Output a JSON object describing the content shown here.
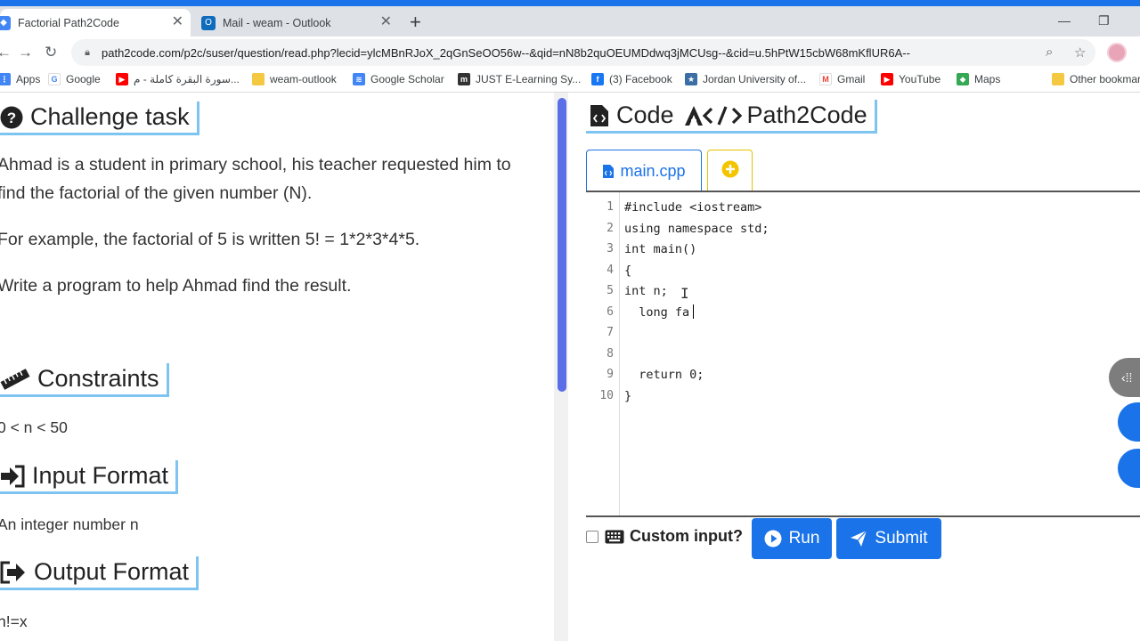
{
  "browser": {
    "tabs": [
      {
        "title": "Factorial Path2Code",
        "active": true,
        "favicon_color": "#4285f4"
      },
      {
        "title": "Mail - weam - Outlook",
        "active": false,
        "favicon_color": "#0f6cbd"
      }
    ],
    "url": "path2code.com/p2c/suser/question/read.php?lecid=ylcMBnRJoX_2qGnSeOO56w--&qid=nN8b2quOEUMDdwq3jMCUsg--&cid=u.5hPtW15cbW68mKflUR6A--",
    "bookmarks": [
      {
        "label": "Apps",
        "icon": "apps-icon",
        "color": "#4285f4"
      },
      {
        "label": "Google",
        "icon": "google-icon",
        "color": "#4285f4"
      },
      {
        "label": "سورة البقرة كاملة - م...",
        "icon": "youtube-icon",
        "color": "#ff0000"
      },
      {
        "label": "weam-outlook",
        "icon": "folder-icon",
        "color": "#f5c842"
      },
      {
        "label": "Google Scholar",
        "icon": "scholar-icon",
        "color": "#4285f4"
      },
      {
        "label": "JUST E-Learning Sy...",
        "icon": "just-icon",
        "color": "#333333"
      },
      {
        "label": "(3) Facebook",
        "icon": "facebook-icon",
        "color": "#1877f2"
      },
      {
        "label": "Jordan University of...",
        "icon": "juniv-icon",
        "color": "#3a6ea5"
      },
      {
        "label": "Gmail",
        "icon": "gmail-icon",
        "color": "#ea4335"
      },
      {
        "label": "YouTube",
        "icon": "youtube-icon",
        "color": "#ff0000"
      },
      {
        "label": "Maps",
        "icon": "maps-icon",
        "color": "#34a853"
      },
      {
        "label": "Other bookmarks",
        "icon": "folder-icon",
        "color": "#f5c842"
      }
    ]
  },
  "challenge": {
    "title": "Challenge task",
    "paragraphs": [
      "Ahmad is a student in primary school, his teacher requested him to find the factorial of the given number (N).",
      "For example, the factorial of 5  is written 5! = 1*2*3*4*5.",
      "Write a program to help Ahmad find the result."
    ],
    "constraints_title": "Constraints",
    "constraints_text": "0 < n < 50",
    "input_title": "Input Format",
    "input_text": "An integer number n",
    "output_title": "Output Format",
    "output_text": "n!=x"
  },
  "code_panel": {
    "title_prefix": "Code",
    "title_brand": "Path2Code",
    "file_tab": "main.cpp",
    "lines": [
      {
        "num": "1",
        "text": "#include <iostream>"
      },
      {
        "num": "2",
        "text": "using namespace std;"
      },
      {
        "num": "3",
        "text": "int main()"
      },
      {
        "num": "4",
        "text": "{"
      },
      {
        "num": "5",
        "text": "int n;"
      },
      {
        "num": "6",
        "text": "  long fa"
      },
      {
        "num": "7",
        "text": ""
      },
      {
        "num": "8",
        "text": ""
      },
      {
        "num": "9",
        "text": "  return 0;"
      },
      {
        "num": "10",
        "text": "}"
      }
    ],
    "custom_input_label": "Custom input?",
    "run_label": "Run",
    "submit_label": "Submit"
  },
  "colors": {
    "accent": "#1a73e8",
    "heading_border": "#7ec4f0",
    "add_tab": "#e6c200",
    "scroll_thumb": "#5a6ee8"
  }
}
